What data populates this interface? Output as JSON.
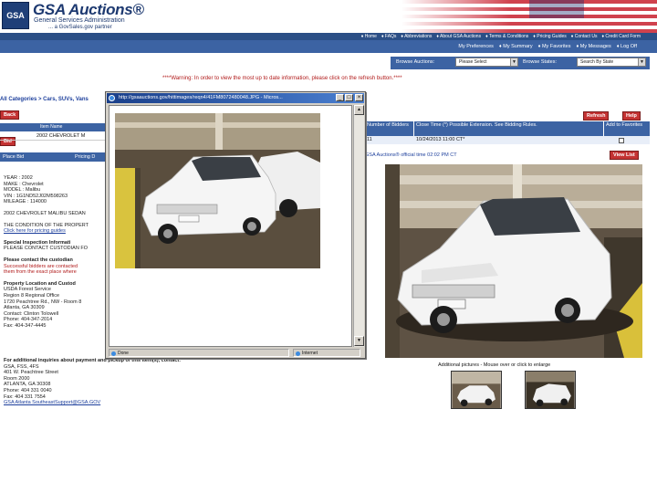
{
  "header": {
    "logo_text": "GSA",
    "brand_title": "GSA Auctions®",
    "brand_subtitle": "General Services Administration",
    "brand_tagline": "... a GovSales.gov partner"
  },
  "topnav": {
    "items": [
      "♦ Home",
      "♦ FAQs",
      "♦ Abbreviations",
      "♦ About GSA Auctions",
      "♦ Terms & Conditions",
      "♦ Pricing Guides",
      "♦ Contact Us",
      "♦ Credit Card Form"
    ]
  },
  "subnav": {
    "items": [
      "My Preferences",
      "♦ My Summary",
      "♦ My Favorites",
      "♦ My Messages",
      "♦ Log Off"
    ]
  },
  "browse": {
    "auctions_label": "Browse Auctions:",
    "auctions_value": "Please Select",
    "states_label": "Browse States:",
    "states_value": "Search By State"
  },
  "warning": "****Warning: In order to view the most up to date information, please click on the refresh button.****",
  "breadcrumb": "All Categories > Cars, SUVs, Vans",
  "buttons": {
    "back": "Back",
    "refresh": "Refresh",
    "help": "Help",
    "bid": "Bid",
    "view_list": "View List"
  },
  "left_table": {
    "header": "Item Name",
    "row_value": "2002 CHEVROLET M",
    "pricing_link": "Pricing D",
    "bid_row_label": "Place Bid"
  },
  "description": {
    "lines": [
      "YEAR : 2002",
      "MAKE : Chevrolet",
      "MODEL : Malibu",
      "VIN : 1G1ND52J02M598263",
      "MILEAGE : 114000"
    ],
    "title_line": "2002 CHEVROLET MALIBU SEDAN",
    "condition_line": "THE CONDITION OF THE PROPERT",
    "pricing_link": "Click here for pricing guides",
    "inspection_heading": "Special Inspection Informati",
    "inspection_detail": "PLEASE CONTACT CUSTODIAN FO",
    "custodian_heading": "Please contact the custodian",
    "custodian_red1": "Successful bidders are contacted",
    "custodian_red2": "them from the exact place where",
    "location_heading": "Property Location and Custod",
    "location_lines": [
      "USDA Forest Service",
      "Region 8 Regional Office",
      "1720 Peachtree Rd., NW - Room 8",
      "Atlanta, GA 30309",
      "Contact: Clinton Tolowell",
      "Phone: 404-347-2014",
      "Fax: 404-347-4445"
    ]
  },
  "contact": {
    "heading": "For additional inquiries about payment and pickup of this item(s), contact:",
    "lines": [
      "GSA, FSS, 4FS",
      "401 W. Peachtree Street",
      "Room 2000",
      "ATLANTA, GA 30308",
      "Phone: 404 331 0040",
      "Fax: 404 331 7554"
    ],
    "email": "GSA Atlanta SoutheastSupport@GSA.GOV"
  },
  "right_table": {
    "headers": [
      "Number of Bidders",
      "Close Time (*) Possible Extension. See Bidding Rules.",
      "Add to Favorites"
    ],
    "row": [
      "11",
      "10/24/2013 11:00 CT*",
      ""
    ]
  },
  "detail_line": "GSA Auctions® official time 02:02 PM CT",
  "additional_pictures_label": "Additional pictures - Mouse over or click to enlarge",
  "popup": {
    "title": "http://gsaauctions.gov/hittimages/reqn4/41FM8072480048.JPG - Micros...",
    "status_done": "Done",
    "status_zone": "Internet",
    "minimize": "_",
    "maximize": "□",
    "close": "×",
    "scroll_up": "▲",
    "scroll_down": "▼"
  }
}
